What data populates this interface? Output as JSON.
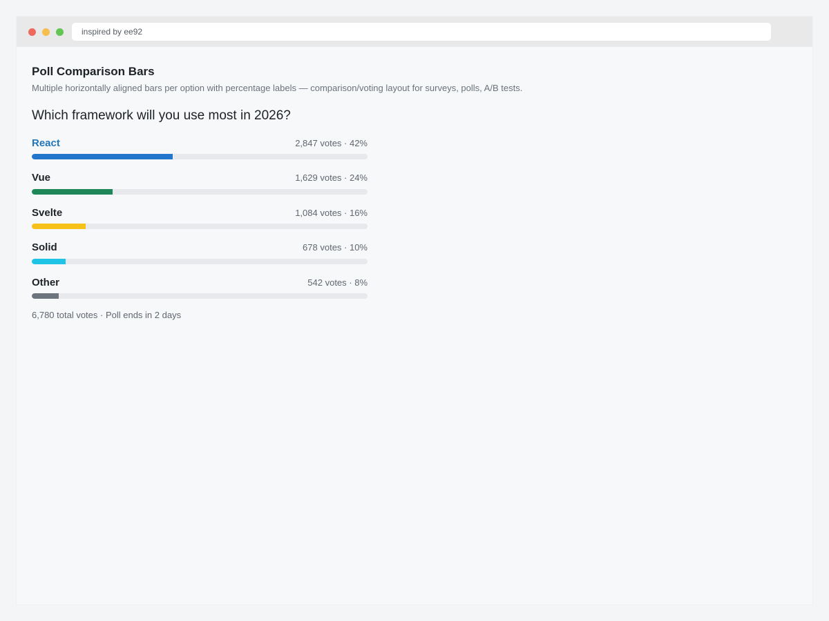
{
  "window": {
    "address": "inspired by ee92",
    "controls": [
      {
        "name": "close",
        "color": "#ee6a5f"
      },
      {
        "name": "minimize",
        "color": "#f5be4f"
      },
      {
        "name": "maximize",
        "color": "#62c554"
      }
    ]
  },
  "header": {
    "title": "Poll Comparison Bars",
    "subtitle": "Multiple horizontally aligned bars per option with percentage labels — comparison/voting layout for surveys, polls, A/B tests."
  },
  "poll": {
    "question": "Which framework will you use most in 2026?",
    "options": [
      {
        "label": "React",
        "votes": 2847,
        "stats": "2,847 votes · 42%",
        "percent": 42,
        "color": "#2277cc",
        "selected": true
      },
      {
        "label": "Vue",
        "votes": 1629,
        "stats": "1,629 votes · 24%",
        "percent": 24,
        "color": "#1d8757",
        "selected": false
      },
      {
        "label": "Svelte",
        "votes": 1084,
        "stats": "1,084 votes · 16%",
        "percent": 16,
        "color": "#f6c21a",
        "selected": false
      },
      {
        "label": "Solid",
        "votes": 678,
        "stats": "678 votes · 10%",
        "percent": 10,
        "color": "#1fc3e6",
        "selected": false
      },
      {
        "label": "Other",
        "votes": 542,
        "stats": "542 votes · 8%",
        "percent": 8,
        "color": "#6c757d",
        "selected": false
      }
    ],
    "footer": "6,780 total votes · Poll ends in 2 days"
  }
}
